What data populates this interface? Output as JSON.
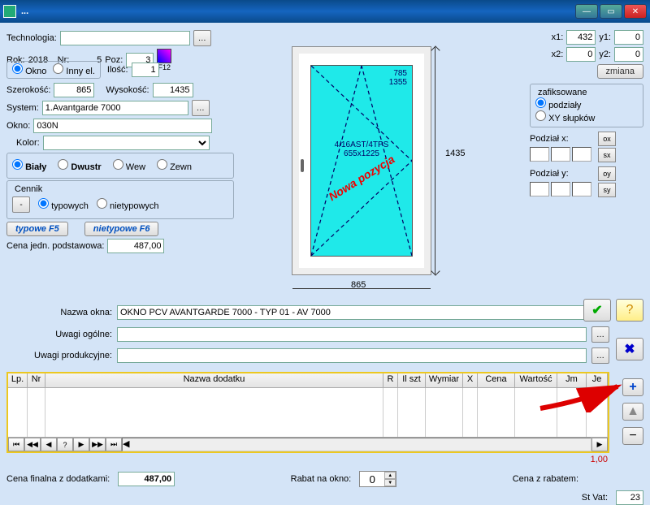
{
  "window_title": "...",
  "left": {
    "technologia_label": "Technologia:",
    "technologia_value": "",
    "rok_label": "Rok:",
    "rok_value": "2018",
    "nr_label": "Nr:",
    "nr_value": "5",
    "poz_label": "Poz:",
    "poz_value": "3",
    "ilosc_label": "Ilość:",
    "ilosc_value": "1",
    "f12_label": "F12",
    "radio_okno": "Okno",
    "radio_inny": "Inny el.",
    "szer_label": "Szerokość:",
    "szer_value": "865",
    "wys_label": "Wysokość:",
    "wys_value": "1435",
    "system_label": "System:",
    "system_value": "1.Avantgarde 7000",
    "okno_label": "Okno:",
    "okno_value": "030N",
    "kolor_label": "Kolor:",
    "kolor_value": "",
    "radio_bialy": "Biały",
    "radio_dwustr": "Dwustr",
    "radio_wew": "Wew",
    "radio_zewn": "Zewn",
    "cennik_label": "Cennik",
    "radio_typ": "typowych",
    "radio_nietyp": "nietypowych",
    "btn_minus": "-",
    "btn_typowe": "typowe F5",
    "btn_nietypowe": "nietypowe F6",
    "cena_jedn_label": "Cena jedn. podstawowa:",
    "cena_jedn_value": "487,00"
  },
  "drawing": {
    "top_text1": "785",
    "top_text2": "1355",
    "mid_text1": "4/16AST/4TPS",
    "mid_text2": "655x1225",
    "diag_text": "Nowa pozycja",
    "dim_right": "1435",
    "dim_bottom": "865"
  },
  "right": {
    "x1_label": "x1:",
    "x1_value": "432",
    "y1_label": "y1:",
    "y1_value": "0",
    "x2_label": "x2:",
    "x2_value": "0",
    "y2_label": "y2:",
    "y2_value": "0",
    "zmiana_btn": "zmiana",
    "zafiksowane_label": "zafiksowane",
    "radio_podzialy": "podziały",
    "radio_xyslupkow": "XY słupków",
    "podzial_x_label": "Podział x:",
    "podzial_y_label": "Podział y:",
    "ox": "ox",
    "sx": "sx",
    "oy": "oy",
    "sy": "sy"
  },
  "mid": {
    "nazwa_okna_label": "Nazwa okna:",
    "nazwa_okna_value": "OKNO PCV AVANTGARDE 7000 - TYP 01 - AV 7000",
    "uwagi_ogolne_label": "Uwagi ogólne:",
    "uwagi_ogolne_value": "",
    "uwagi_prod_label": "Uwagi produkcyjne:",
    "uwagi_prod_value": ""
  },
  "table": {
    "headers": [
      "Lp.",
      "Nr",
      "Nazwa dodatku",
      "R",
      "Il szt",
      "Wymiar",
      "X",
      "Cena",
      "Wartość",
      "Jm",
      "Je"
    ],
    "nav_question": "?",
    "row_total": "1,00"
  },
  "bottom": {
    "cena_final_label": "Cena finalna z dodatkami:",
    "cena_final_value": "487,00",
    "rabat_label": "Rabat na okno:",
    "rabat_value": "0",
    "cena_rabat_label": "Cena z rabatem:",
    "stvat_label": "St Vat:",
    "stvat_value": "23"
  },
  "icons": {
    "help": "?",
    "ok": "✔",
    "cancel": "✖",
    "plus": "+",
    "up": "▲",
    "minus": "−",
    "ellipsis": "…",
    "dropdown": "▼"
  }
}
